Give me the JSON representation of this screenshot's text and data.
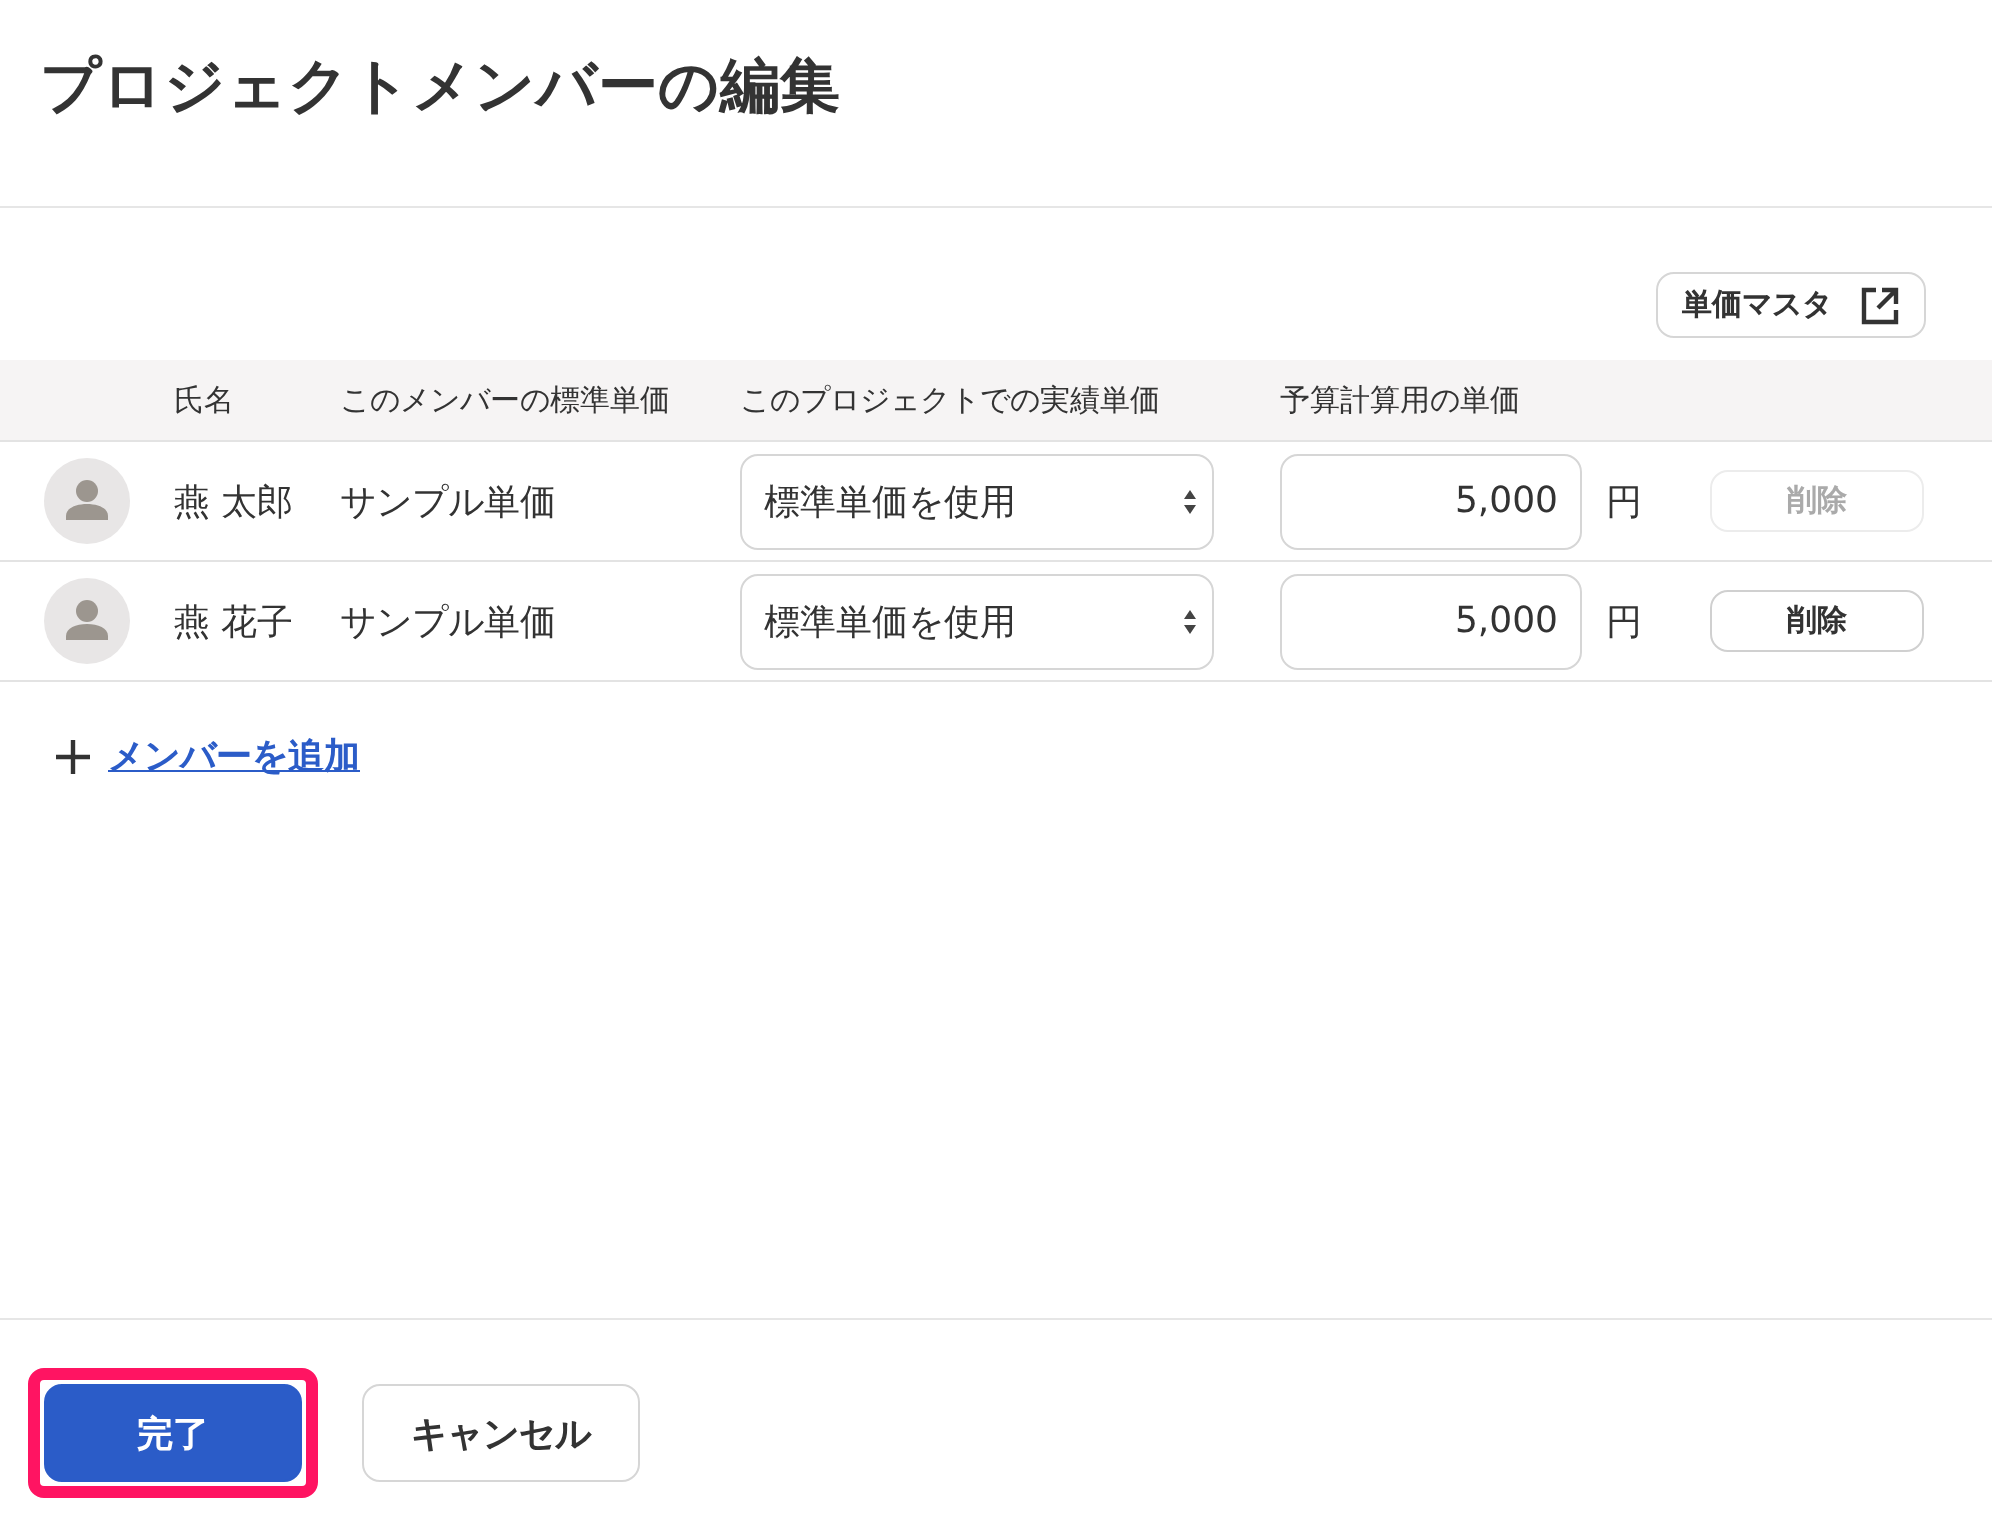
{
  "title": "プロジェクトメンバーの編集",
  "master_button": {
    "label": "単価マスタ"
  },
  "table": {
    "columns": [
      "氏名",
      "このメンバーの標準単価",
      "このプロジェクトでの実績単価",
      "予算計算用の単価"
    ],
    "rows": [
      {
        "name": "燕 太郎",
        "standard_rate": "サンプル単価",
        "actual_rate": "標準単価を使用",
        "budget_rate": "5,000",
        "unit": "円",
        "delete": {
          "label": "削除",
          "disabled": true
        }
      },
      {
        "name": "燕 花子",
        "standard_rate": "サンプル単価",
        "actual_rate": "標準単価を使用",
        "budget_rate": "5,000",
        "unit": "円",
        "delete": {
          "label": "削除",
          "disabled": false
        }
      }
    ]
  },
  "add_member": {
    "label": "メンバーを追加"
  },
  "footer": {
    "buttons": [
      {
        "label": "完了",
        "kind": "primary",
        "highlighted": true
      },
      {
        "label": "キャンセル",
        "kind": "secondary",
        "highlighted": false
      }
    ]
  }
}
